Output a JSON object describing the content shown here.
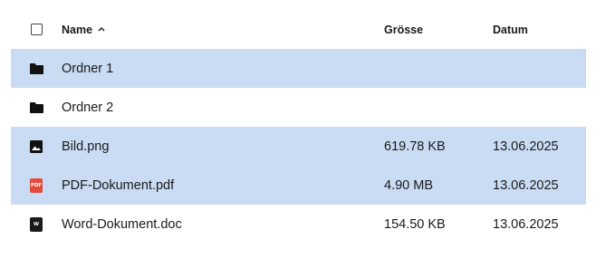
{
  "columns": {
    "name": "Name",
    "size": "Grösse",
    "date": "Datum",
    "sort_indicator": "^"
  },
  "colors": {
    "selected_row": "#c9dcf4",
    "pdf_badge": "#e24b3b",
    "doc_badge": "#1a1a1a"
  },
  "files": [
    {
      "icon": "folder-icon",
      "name": "Ordner 1",
      "size": "",
      "date": "",
      "selected": true
    },
    {
      "icon": "folder-icon",
      "name": "Ordner 2",
      "size": "",
      "date": "",
      "selected": false
    },
    {
      "icon": "image-icon",
      "name": "Bild.png",
      "size": "619.78 KB",
      "date": "13.06.2025",
      "selected": true
    },
    {
      "icon": "pdf-icon",
      "badge": "PDF",
      "name": "PDF-Dokument.pdf",
      "size": "4.90 MB",
      "date": "13.06.2025",
      "selected": true
    },
    {
      "icon": "word-icon",
      "badge": "W",
      "name": "Word-Dokument.doc",
      "size": "154.50 KB",
      "date": "13.06.2025",
      "selected": false
    }
  ]
}
